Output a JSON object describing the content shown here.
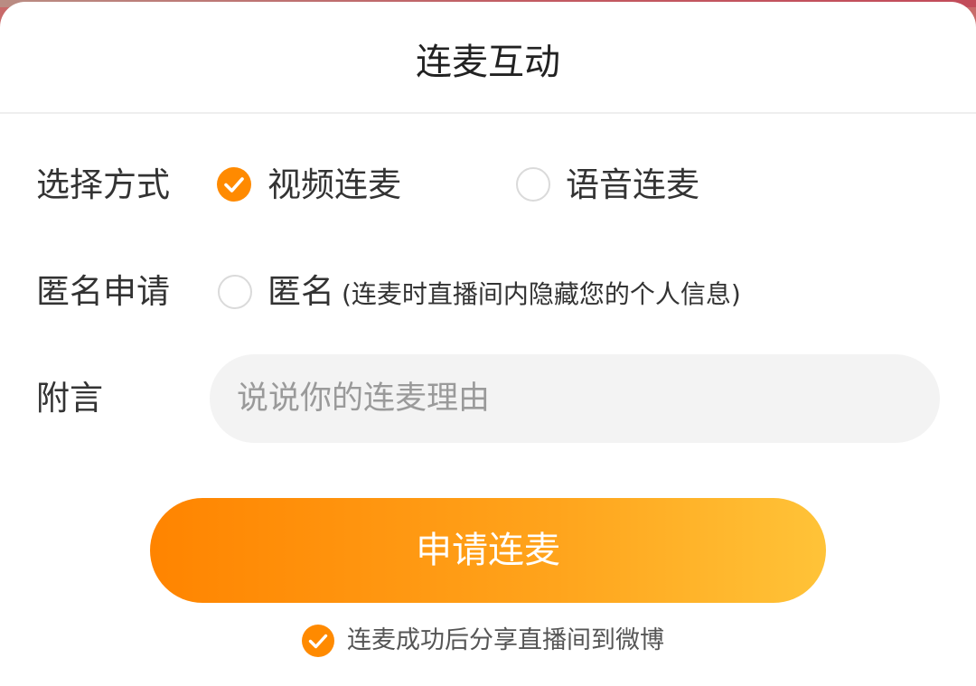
{
  "title": "连麦互动",
  "method": {
    "label": "选择方式",
    "options": [
      {
        "label": "视频连麦",
        "selected": true
      },
      {
        "label": "语音连麦",
        "selected": false
      }
    ]
  },
  "anonymous": {
    "label": "匿名申请",
    "option_label": "匿名",
    "hint": "(连麦时直播间内隐藏您的个人信息)",
    "selected": false
  },
  "message": {
    "label": "附言",
    "placeholder": "说说你的连麦理由",
    "value": ""
  },
  "submit_label": "申请连麦",
  "share": {
    "label": "连麦成功后分享直播间到微博",
    "checked": true
  },
  "colors": {
    "accent": "#ff8a00",
    "button_gradient_start": "#ff8400",
    "button_gradient_end": "#ffc338",
    "input_bg": "#f3f3f3"
  },
  "icons": {
    "checked": "check-circle-icon",
    "unchecked": "empty-circle-icon"
  }
}
